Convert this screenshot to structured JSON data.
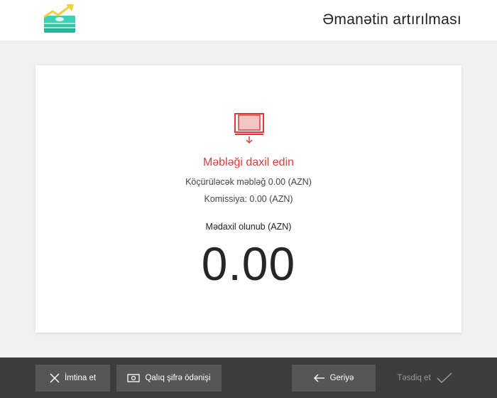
{
  "header": {
    "title": "Əmanətin artırılması",
    "logo_icon": "money-growth-icon"
  },
  "card": {
    "icon": "insert-banknote-icon",
    "title": "Məbləği daxil edin",
    "transfer_amount": "Köçürüləcək məbləğ  0.00 (AZN)",
    "commission": "Komissiya: 0.00 (AZN)",
    "inserted_label": "Mədaxil olunub (AZN)",
    "inserted_amount": "0.00"
  },
  "footer": {
    "cancel_label": "İmtina et",
    "change_payment_label": "Qalıq şifrə ödənişi",
    "back_label": "Geriyə",
    "confirm_label": "Təsdiq et"
  },
  "colors": {
    "accent_red": "#e03b3b",
    "footer_bg": "#3c3c3c",
    "button_bg": "#565656"
  }
}
